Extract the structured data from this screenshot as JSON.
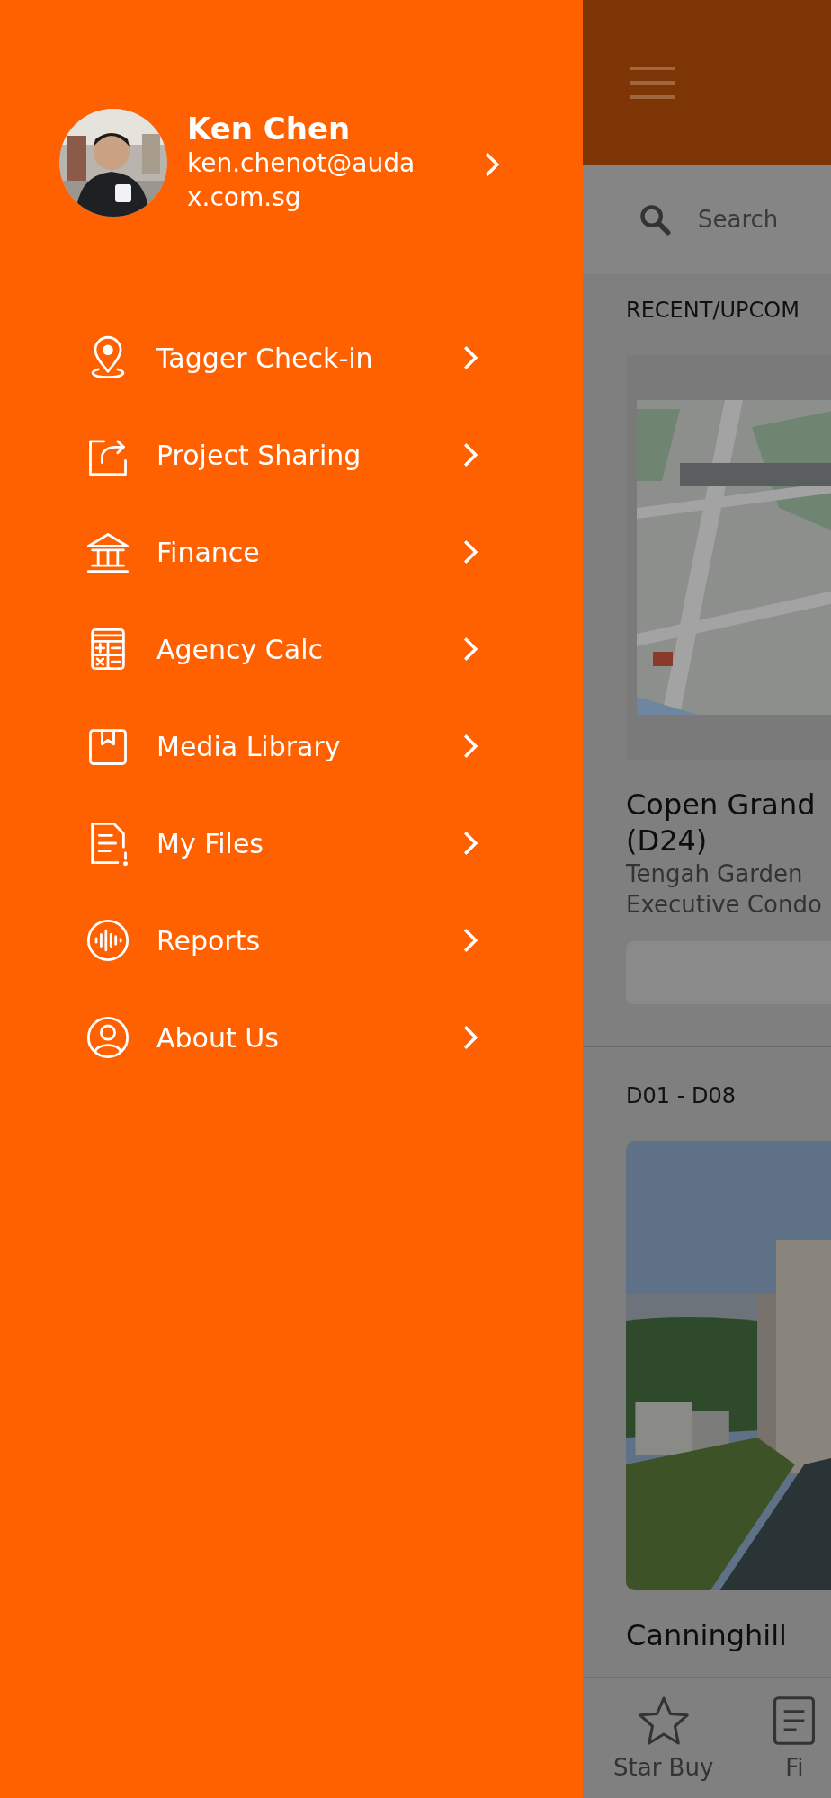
{
  "drawer": {
    "profile": {
      "name": "Ken Chen",
      "email": "ken.chenot@audax.com.sg"
    },
    "items": [
      {
        "label": "Tagger Check-in",
        "kind": "pin"
      },
      {
        "label": "Project Sharing",
        "kind": "share"
      },
      {
        "label": "Finance",
        "kind": "bank"
      },
      {
        "label": "Agency Calc",
        "kind": "calculator"
      },
      {
        "label": "Media Library",
        "kind": "box"
      },
      {
        "label": "My Files",
        "kind": "file"
      },
      {
        "label": "Reports",
        "kind": "audio"
      },
      {
        "label": "About Us",
        "kind": "user"
      }
    ]
  },
  "main": {
    "search": {
      "placeholder": "Search"
    },
    "sections": [
      {
        "heading": "RECENT/UPCOM",
        "card": {
          "kind": "map",
          "title_lines": [
            "Copen Grand",
            "(D24)"
          ],
          "subtitle_lines": [
            "Tengah Garden",
            "Executive Condo"
          ]
        }
      },
      {
        "heading": "D01 - D08",
        "card": {
          "kind": "city",
          "title_lines": [
            "Canninghill"
          ]
        }
      }
    ],
    "nav": [
      {
        "label": "Star Buy",
        "kind": "star"
      },
      {
        "label": "Fi",
        "kind": "file"
      }
    ]
  }
}
